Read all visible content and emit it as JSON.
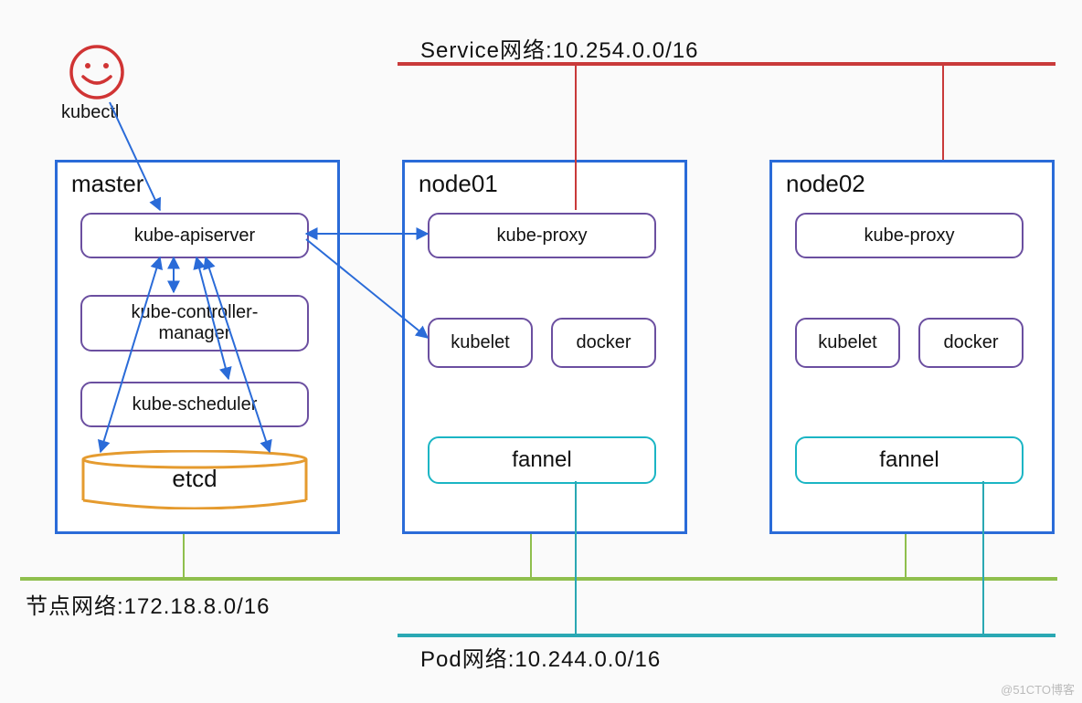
{
  "kubectl_label": "kubectl",
  "clusters": {
    "master": {
      "title": "master"
    },
    "node01": {
      "title": "node01"
    },
    "node02": {
      "title": "node02"
    }
  },
  "master_components": {
    "apiserver": "kube-apiserver",
    "controller": "kube-controller-\nmanager",
    "scheduler": "kube-scheduler",
    "etcd": "etcd"
  },
  "node_components": {
    "kube_proxy": "kube-proxy",
    "kubelet": "kubelet",
    "docker": "docker",
    "fannel": "fannel"
  },
  "networks": {
    "service": {
      "label": "Service网络:10.254.0.0/16",
      "cidr": "10.254.0.0/16",
      "color": "#c93a3a"
    },
    "node": {
      "label": "节点网络:172.18.8.0/16",
      "cidr": "172.18.8.0/16",
      "color": "#8fbf4d"
    },
    "pod": {
      "label": "Pod网络:10.244.0.0/16",
      "cidr": "10.244.0.0/16",
      "color": "#2aa8b3"
    }
  },
  "watermark": "@51CTO博客",
  "colors": {
    "cluster_border": "#2a6bd8",
    "component_border": "#6b4fa0",
    "component_border_alt": "#1bb5c4",
    "etcd_border": "#e59b2f",
    "arrow": "#2a6bd8",
    "smiley": "#d03434"
  }
}
